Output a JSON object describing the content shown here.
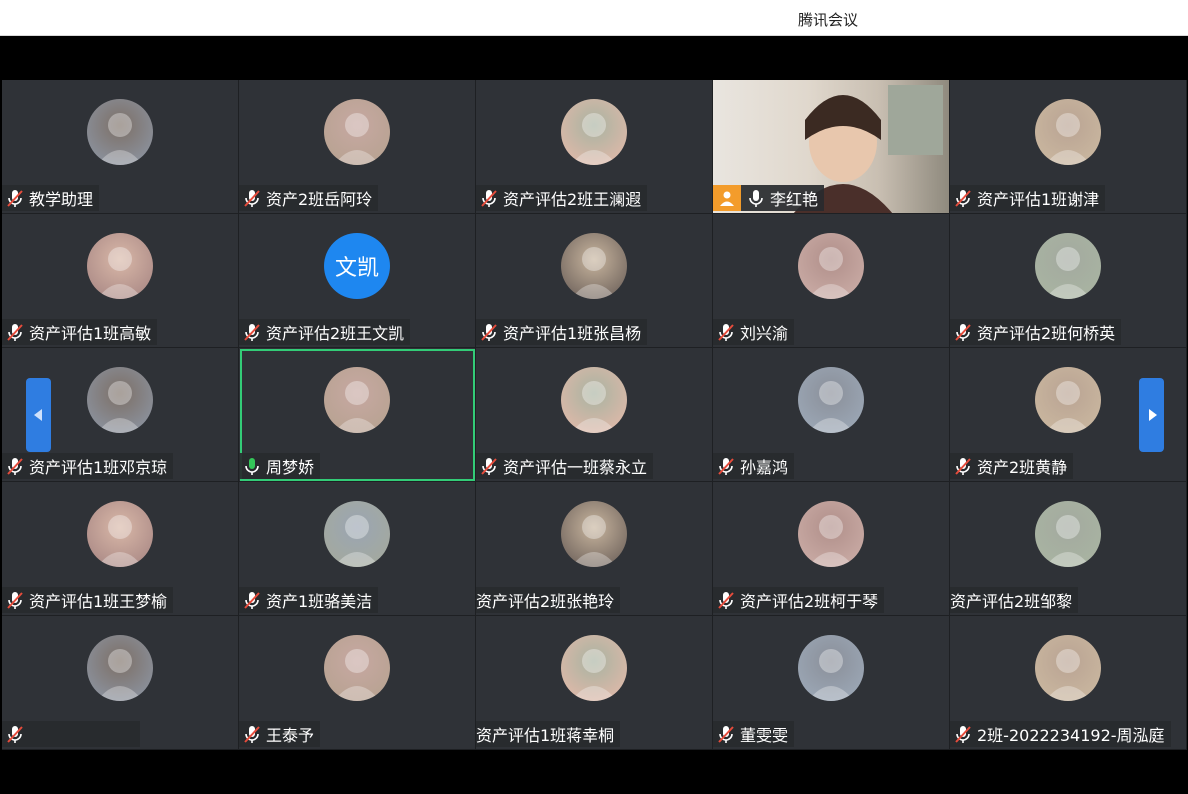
{
  "window": {
    "title": "腾讯会议"
  },
  "colors": {
    "tile_bg": "#2f3237",
    "active_border": "#33cc77",
    "nav_button": "#2f7de1",
    "host_badge": "#f39c2b",
    "mic_active": "#34c759",
    "text_avatar": "#1e87f0"
  },
  "navigation": {
    "prev_icon": "chevron-left-icon",
    "next_icon": "chevron-right-icon"
  },
  "participants": [
    {
      "name": "教学助理",
      "mic": "muted",
      "avatar_icon": "silhouette-avatar"
    },
    {
      "name": "资产2班岳阿玲",
      "mic": "muted",
      "avatar_icon": "photo-avatar"
    },
    {
      "name": "资产评估2班王澜遐",
      "mic": "muted",
      "avatar_icon": "photo-avatar"
    },
    {
      "name": "李红艳",
      "mic": "on",
      "host": true,
      "video": true
    },
    {
      "name": "资产评估1班谢津",
      "mic": "muted",
      "avatar_icon": "photo-avatar"
    },
    {
      "name": "资产评估1班高敏",
      "mic": "muted",
      "avatar_icon": "photo-avatar"
    },
    {
      "name": "资产评估2班王文凯",
      "mic": "muted",
      "avatar_text": "文凯"
    },
    {
      "name": "资产评估1班张昌杨",
      "mic": "muted",
      "avatar_icon": "photo-avatar"
    },
    {
      "name": "刘兴渝",
      "mic": "muted",
      "avatar_icon": "cartoon-avatar"
    },
    {
      "name": "资产评估2班何桥英",
      "mic": "muted",
      "avatar_icon": "cartoon-avatar"
    },
    {
      "name": "资产评估1班邓京琼",
      "mic": "muted",
      "avatar_icon": "cartoon-avatar"
    },
    {
      "name": "周梦娇",
      "mic": "speaking",
      "active": true,
      "avatar_icon": "photo-avatar"
    },
    {
      "name": "资产评估一班蔡永立",
      "mic": "muted",
      "avatar_icon": "cartoon-avatar"
    },
    {
      "name": "孙嘉鸿",
      "mic": "muted",
      "avatar_icon": "cartoon-avatar"
    },
    {
      "name": "资产2班黄静",
      "mic": "muted",
      "avatar_icon": "cartoon-avatar"
    },
    {
      "name": "资产评估1班王梦榆",
      "mic": "muted",
      "avatar_icon": "photo-avatar"
    },
    {
      "name": "资产1班骆美洁",
      "mic": "muted",
      "avatar_icon": "photo-avatar"
    },
    {
      "name": "资产评估2班张艳玲",
      "mic": "none",
      "avatar_icon": "cartoon-avatar"
    },
    {
      "name": "资产评估2班柯于琴",
      "mic": "muted",
      "avatar_icon": "photo-avatar"
    },
    {
      "name": "资产评估2班邹黎",
      "mic": "none",
      "avatar_icon": "photo-avatar"
    },
    {
      "name": "",
      "mic": "muted",
      "avatar_icon": "photo-avatar"
    },
    {
      "name": "王泰予",
      "mic": "muted",
      "avatar_icon": "photo-avatar"
    },
    {
      "name": "资产评估1班蒋幸桐",
      "mic": "none",
      "avatar_icon": "photo-avatar"
    },
    {
      "name": "董雯雯",
      "mic": "muted",
      "avatar_icon": "photo-avatar"
    },
    {
      "name": "2班-2022234192-周泓庭",
      "mic": "muted",
      "avatar_icon": "photo-avatar"
    }
  ]
}
